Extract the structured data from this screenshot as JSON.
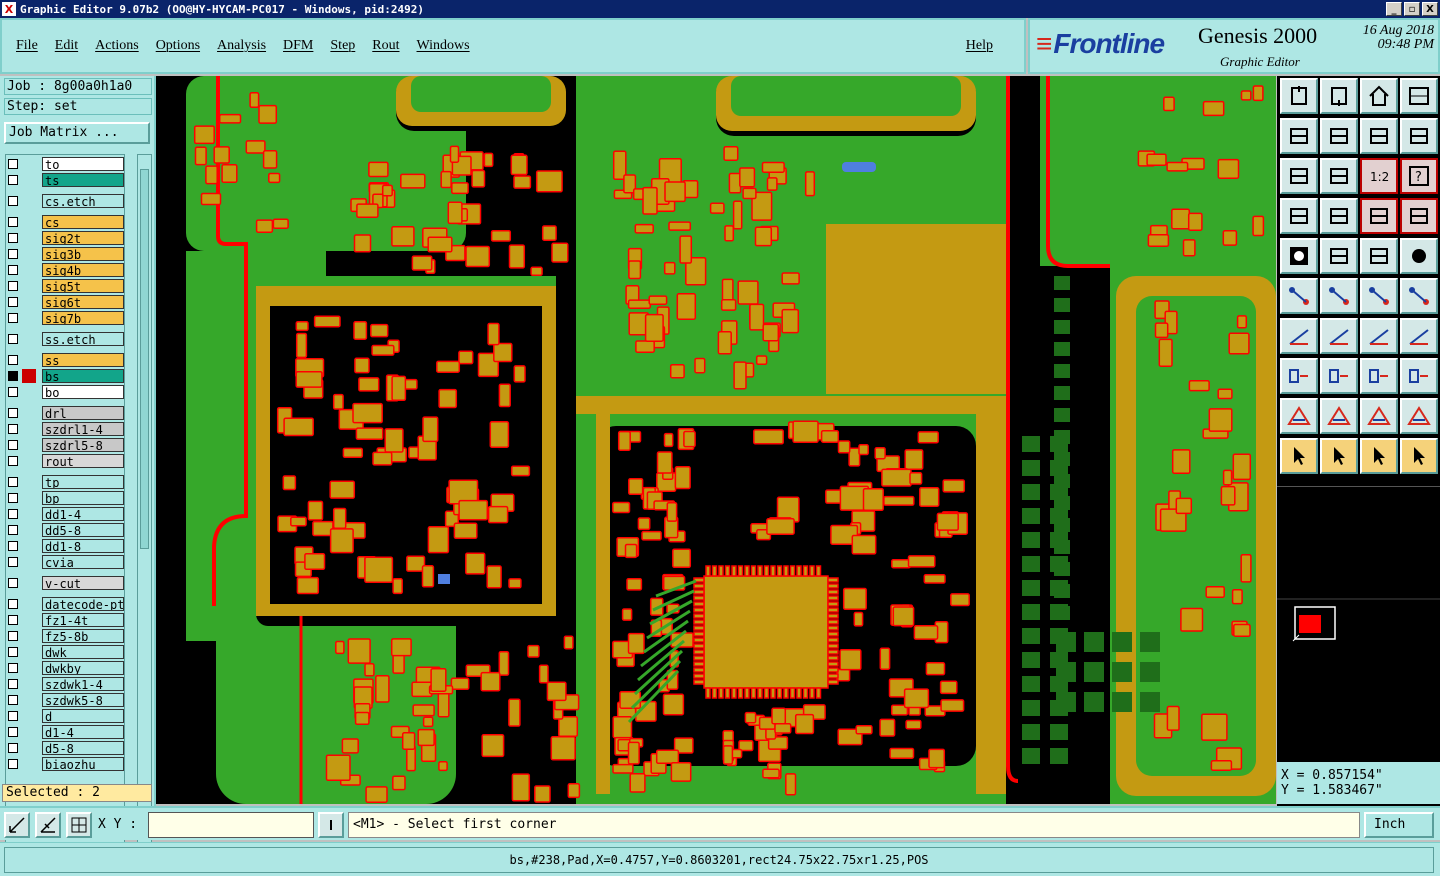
{
  "window": {
    "title": "Graphic Editor 9.07b2 (OO@HY-HYCAM-PC017 - Windows, pid:2492)",
    "controls": [
      "_",
      "▫",
      "X"
    ]
  },
  "menu": {
    "items": [
      "File",
      "Edit",
      "Actions",
      "Options",
      "Analysis",
      "DFM",
      "Step",
      "Rout",
      "Windows"
    ],
    "help": "Help"
  },
  "brand": {
    "logo": "Frontline",
    "product": "Genesis 2000",
    "subtitle": "Graphic Editor",
    "date": "16 Aug 2018",
    "time": "09:48 PM"
  },
  "job": {
    "job_label": "Job : 8g00a0h1a0",
    "step_label": "Step: set",
    "matrix_button": "Job Matrix ..."
  },
  "layers": [
    {
      "name": "to",
      "color": "#ffffff"
    },
    {
      "name": "ts",
      "color": "#12a58a"
    },
    {
      "name": "cs.etch",
      "color": "#aee7e4"
    },
    {
      "name": "cs",
      "color": "#f5c24a"
    },
    {
      "name": "sig2t",
      "color": "#f5c24a"
    },
    {
      "name": "sig3b",
      "color": "#f5c24a"
    },
    {
      "name": "sig4b",
      "color": "#f5c24a"
    },
    {
      "name": "sig5t",
      "color": "#f5c24a"
    },
    {
      "name": "sig6t",
      "color": "#f5c24a"
    },
    {
      "name": "sig7b",
      "color": "#f5c24a"
    },
    {
      "name": "ss.etch",
      "color": "#aee7e4"
    },
    {
      "name": "ss",
      "color": "#f5c24a"
    },
    {
      "name": "bs",
      "color": "#12a58a",
      "selected": true
    },
    {
      "name": "bo",
      "color": "#ffffff"
    },
    {
      "name": "drl",
      "color": "#c8c8c8"
    },
    {
      "name": "szdrl1-4",
      "color": "#c8c8c8"
    },
    {
      "name": "szdrl5-8",
      "color": "#c8c8c8"
    },
    {
      "name": "rout",
      "color": "#d8d8d8"
    },
    {
      "name": "tp",
      "color": "#aee7e4"
    },
    {
      "name": "bp",
      "color": "#aee7e4"
    },
    {
      "name": "dd1-4",
      "color": "#aee7e4"
    },
    {
      "name": "dd5-8",
      "color": "#aee7e4"
    },
    {
      "name": "dd1-8",
      "color": "#aee7e4"
    },
    {
      "name": "cvia",
      "color": "#aee7e4"
    },
    {
      "name": "v-cut",
      "color": "#d8d8d8"
    },
    {
      "name": "datecode-pte",
      "color": "#aee7e4"
    },
    {
      "name": "fz1-4t",
      "color": "#aee7e4"
    },
    {
      "name": "fz5-8b",
      "color": "#aee7e4"
    },
    {
      "name": "dwk",
      "color": "#aee7e4"
    },
    {
      "name": "dwkby",
      "color": "#aee7e4"
    },
    {
      "name": "szdwk1-4",
      "color": "#aee7e4"
    },
    {
      "name": "szdwk5-8",
      "color": "#aee7e4"
    },
    {
      "name": "d",
      "color": "#aee7e4"
    },
    {
      "name": "d1-4",
      "color": "#aee7e4"
    },
    {
      "name": "d5-8",
      "color": "#aee7e4"
    },
    {
      "name": "biaozhu",
      "color": "#aee7e4"
    }
  ],
  "selected_count": "Selected : 2",
  "coords": {
    "x": "X = 0.857154\"",
    "y": "Y = 1.583467\""
  },
  "bottom": {
    "xy_label": "X Y :",
    "xy_value": "",
    "prompt": "<M1> - Select first corner",
    "units": "Inch"
  },
  "status": "bs,#238,Pad,X=0.4757,Y=0.8603201,rect24.75x22.75xr1.25,POS",
  "colors": {
    "board_green": "#36a82a",
    "pad_gold": "#c49a12",
    "outline_red": "#ff0000",
    "panel_cyan": "#aee7e4"
  },
  "tools": [
    "top-view-icon",
    "bottom-view-icon",
    "home-icon",
    "split-view-icon",
    "pan-left-icon",
    "pan-right-icon",
    "flip-icon",
    "mirror-icon",
    "zoom-fit-icon",
    "zoom-center-icon",
    "scale-1-2-icon",
    "help-icon",
    "measure-icon",
    "grid-icon",
    "layer-up-icon",
    "layer-down-icon",
    "fill-icon",
    "outline-icon",
    "ruler-icon",
    "dot-icon",
    "connect-icon",
    "cross-icon",
    "line-icon",
    "line-alt-icon",
    "angle-icon",
    "diag-icon",
    "arc-icon",
    "text-icon",
    "point-icon",
    "minus-icon",
    "dimension-icon",
    "group-icon",
    "triangle-icon",
    "triangle-a-icon",
    "triangle-b-icon",
    "triangle-c-icon",
    "select-icon",
    "select-box-icon",
    "select-alt-icon",
    "route-select-icon"
  ]
}
